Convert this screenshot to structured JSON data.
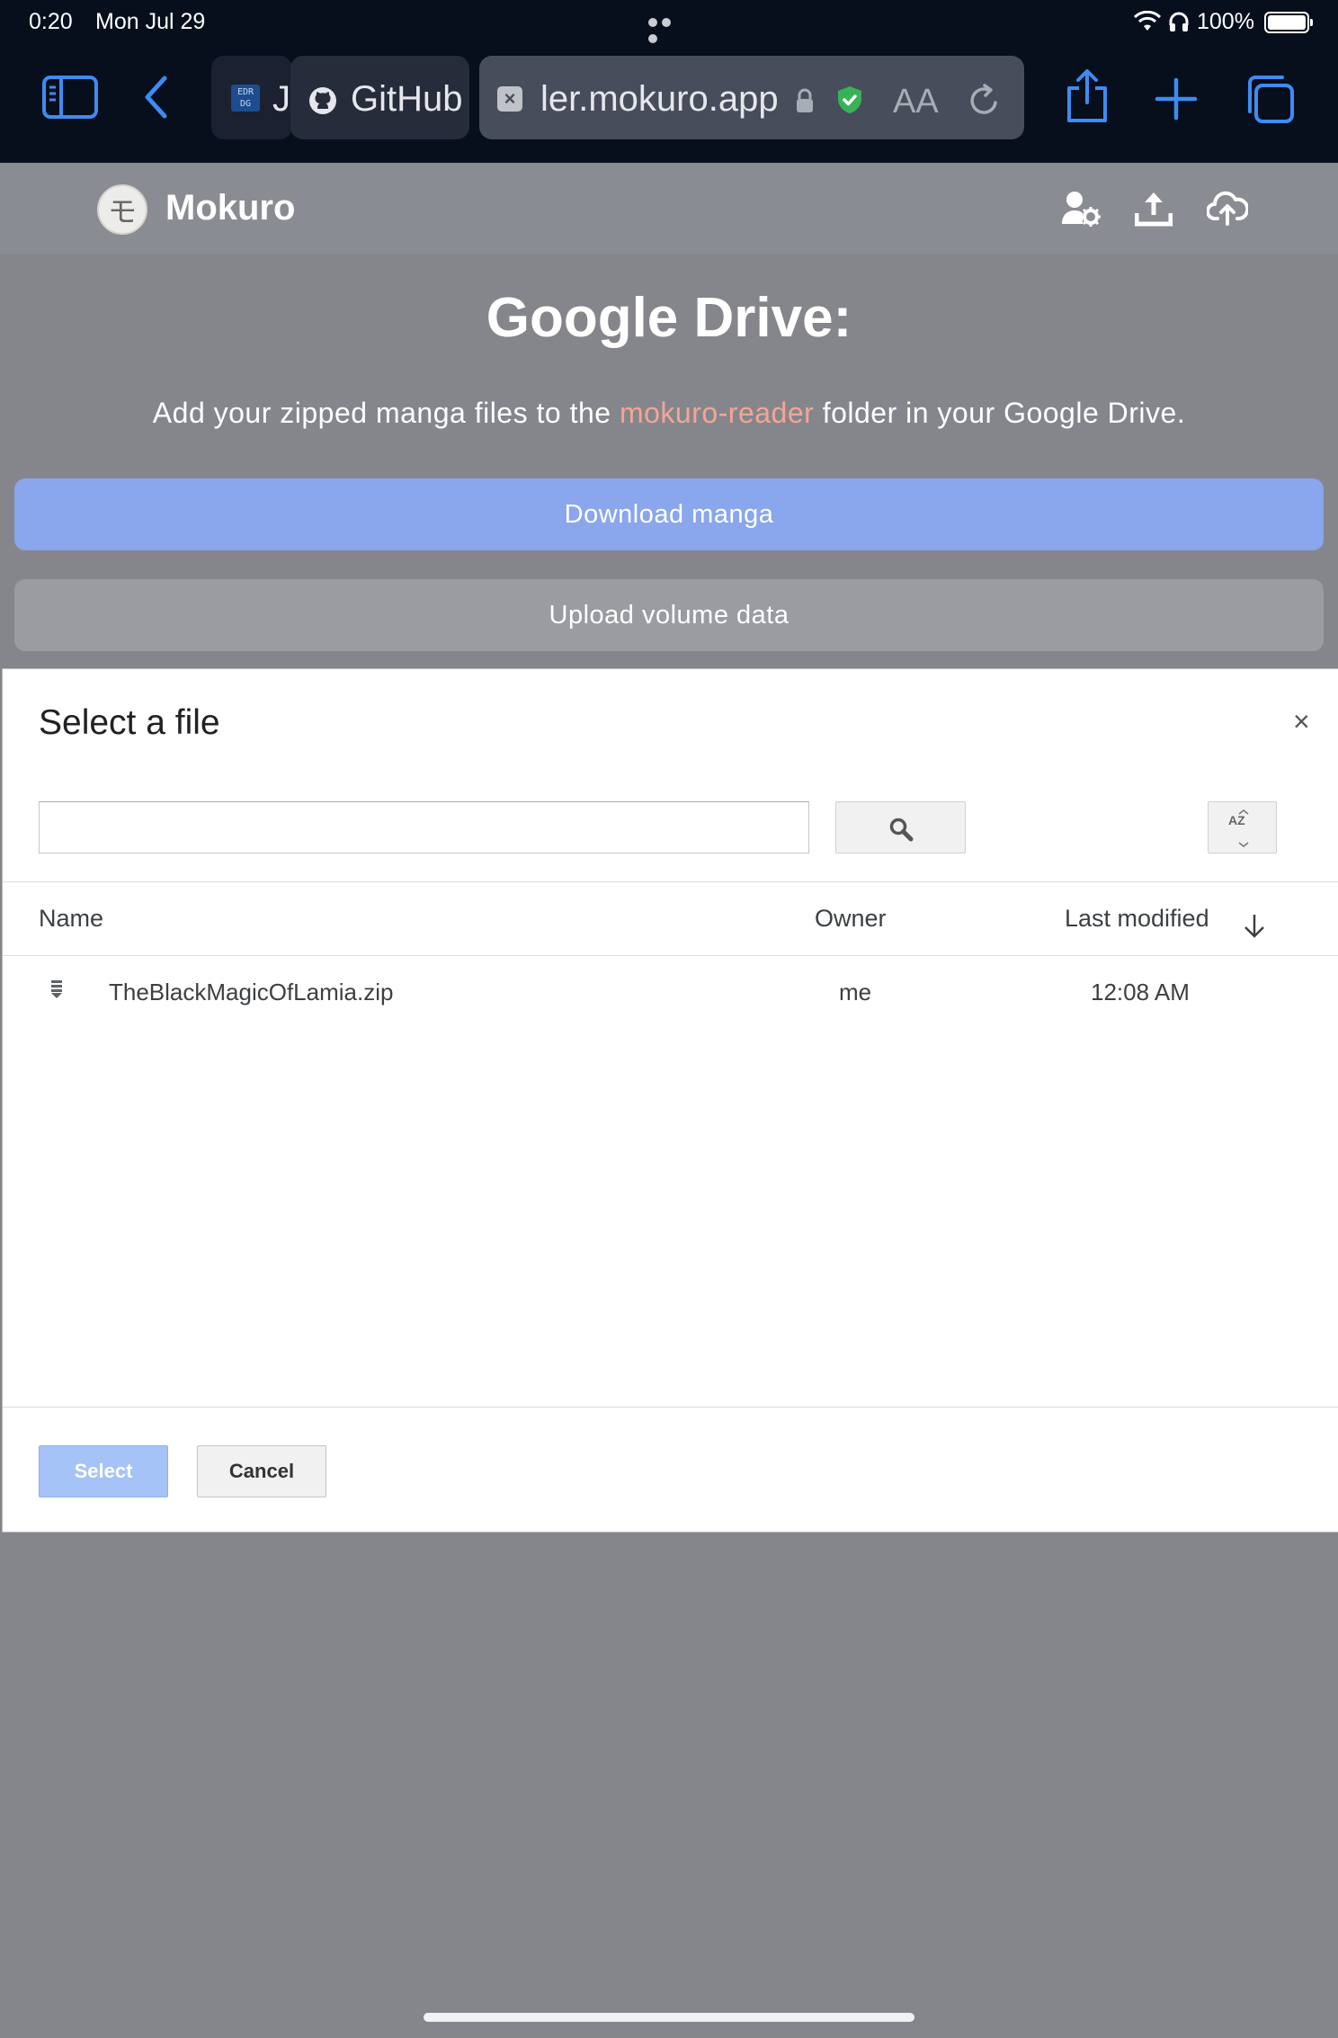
{
  "status_bar": {
    "time": "0:20",
    "date": "Mon Jul 29",
    "battery": "100%"
  },
  "browser": {
    "tabs": [
      {
        "label": "J",
        "favicon": "EDR DG"
      },
      {
        "label": "GitHub",
        "favicon": "github-icon"
      },
      {
        "label": "ler.mokuro.app",
        "favicon": "close-icon",
        "active": true
      }
    ],
    "reader_label": "AA",
    "accent_color": "#3d8cf2"
  },
  "app": {
    "logo_glyph": "モ",
    "name": "Mokuro"
  },
  "page": {
    "title": "Google Drive:",
    "desc_before": "Add your zipped manga files to the ",
    "desc_link": "mokuro-reader",
    "desc_after": " folder in your Google Drive.",
    "download_button": "Download manga",
    "upload_button": "Upload volume data"
  },
  "picker": {
    "title": "Select a file",
    "close_glyph": "×",
    "search_value": "",
    "sort_label": "AZ",
    "columns": {
      "name": "Name",
      "owner": "Owner",
      "modified": "Last modified"
    },
    "files": [
      {
        "name": "TheBlackMagicOfLamia.zip",
        "owner": "me",
        "modified": "12:08 AM"
      }
    ],
    "select_button": "Select",
    "cancel_button": "Cancel"
  }
}
